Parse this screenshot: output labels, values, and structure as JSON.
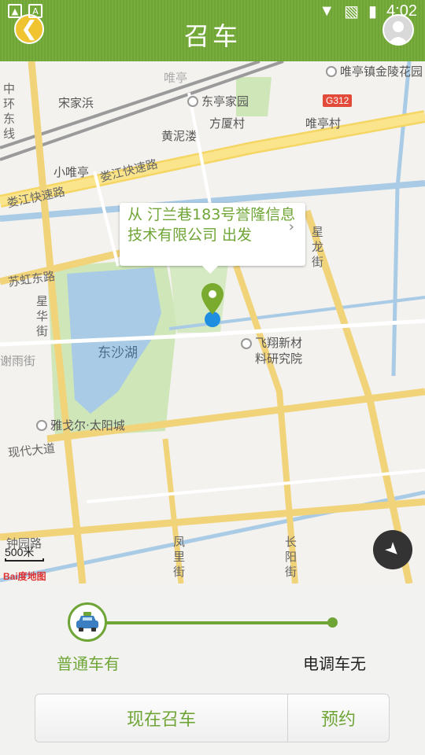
{
  "status_bar": {
    "time": "4:02"
  },
  "header": {
    "title": "召车"
  },
  "map": {
    "callout_text": "从 汀兰巷183号誉隆信息技术有限公司 出发",
    "callout_arrow": "›",
    "highway_sign": "G312",
    "scale_text": "500米",
    "logo_text": "Bai度地图",
    "labels": {
      "zhonghuan_dongxian": "中环东线",
      "song_jia_bin": "宋家浜",
      "dongting_jiayuan": "东亭家园",
      "huang_ni_lou": "黄泥溇",
      "fang_sha_cun": "方厦村",
      "wei_ting_cun": "唯亭村",
      "weiting_jinjin": "唯亭镇金陵花园",
      "xiao_wei_ting": "小唯亭",
      "loujiang_kuaisu_1": "娄江快速路",
      "loujiang_kuaisu_2": "娄江快速路",
      "suhong_dong_lu": "苏虹东路",
      "xing_long_jie": "星龙街",
      "xing_hua_jie": "星华街",
      "dong_sha_hu": "东沙湖",
      "feixiang": "飞翔新材料研究院",
      "xie_yu_jie": "谢雨街",
      "yage_taiyang": "雅戈尔·太阳城",
      "xiandai_dadao": "现代大道",
      "zhongyuan_lu": "钟园路",
      "feng_li_jie": "凤里街",
      "chang_yang_jie": "长阳街",
      "wei_ting": "唯亭"
    }
  },
  "panel": {
    "option_left": "普通车有",
    "option_right": "电调车无",
    "slider_position": 0.0,
    "now_button": "现在召车",
    "book_button": "预约"
  },
  "colors": {
    "accent": "#6fa536",
    "back_button": "#f0c330",
    "locate_button": "#333333"
  }
}
